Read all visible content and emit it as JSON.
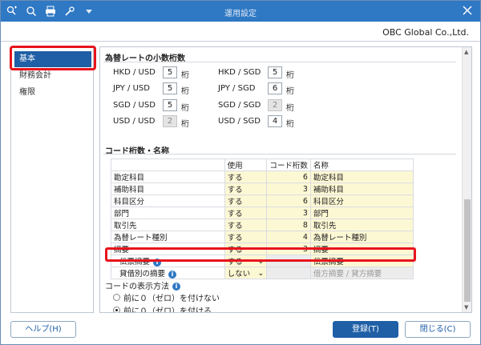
{
  "window": {
    "title": "運用設定",
    "company": "OBC Global Co.,Ltd."
  },
  "titlebar_icons": [
    "search-plus-icon",
    "search-doc-icon",
    "print-icon",
    "settings-tool-icon",
    "dropdown-icon"
  ],
  "sidebar": {
    "items": [
      {
        "label": "基本",
        "active": true
      },
      {
        "label": "財務会計"
      },
      {
        "label": "権限"
      }
    ]
  },
  "rates": {
    "heading": "為替レートの小数桁数",
    "unit": "桁",
    "pairs": [
      {
        "label": "HKD / USD",
        "value": "5"
      },
      {
        "label": "HKD / SGD",
        "value": "5"
      },
      {
        "label": "JPY / USD",
        "value": "5"
      },
      {
        "label": "JPY / SGD",
        "value": "6"
      },
      {
        "label": "SGD / USD",
        "value": "5"
      },
      {
        "label": "SGD / SGD",
        "value": "2"
      },
      {
        "label": "USD / USD",
        "value": "2"
      },
      {
        "label": "USD / SGD",
        "value": "4"
      }
    ]
  },
  "codes": {
    "heading": "コード桁数・名称",
    "headers": [
      "",
      "使用",
      "コード桁数",
      "名称"
    ],
    "rows": [
      {
        "item": "勘定科目",
        "use": "する",
        "digits": "6",
        "name": "勘定科目"
      },
      {
        "item": "補助科目",
        "use": "する",
        "digits": "3",
        "name": "補助科目"
      },
      {
        "item": "科目区分",
        "use": "する",
        "digits": "6",
        "name": "科目区分"
      },
      {
        "item": "部門",
        "use": "する",
        "digits": "3",
        "name": "部門"
      },
      {
        "item": "取引先",
        "use": "する",
        "digits": "8",
        "name": "取引先"
      },
      {
        "item": "為替レート種別",
        "use": "する",
        "digits": "4",
        "name": "為替レート種別"
      },
      {
        "item": "摘要",
        "use": "する",
        "digits": "3",
        "name": "摘要"
      },
      {
        "item": "伝票摘要",
        "use": "する",
        "digits": "",
        "name": "伝票摘要"
      },
      {
        "item": "貸借別の摘要",
        "use": "しない",
        "digits": "",
        "name": "借方摘要 / 貸方摘要"
      }
    ]
  },
  "display": {
    "heading": "コードの表示方法",
    "options": [
      {
        "label": "前に０（ゼロ）を付けない",
        "selected": false
      },
      {
        "label": "前に０（ゼロ）を付ける",
        "selected": true
      }
    ]
  },
  "buttons": {
    "help": "ヘルプ(H)",
    "register": "登録(T)",
    "close": "閉じる(C)"
  },
  "colors": {
    "titlebar": "#2f78c4",
    "selection": "#1e5fa6",
    "highlight": "#e8141c",
    "input_bg": "#fdf8d4"
  }
}
